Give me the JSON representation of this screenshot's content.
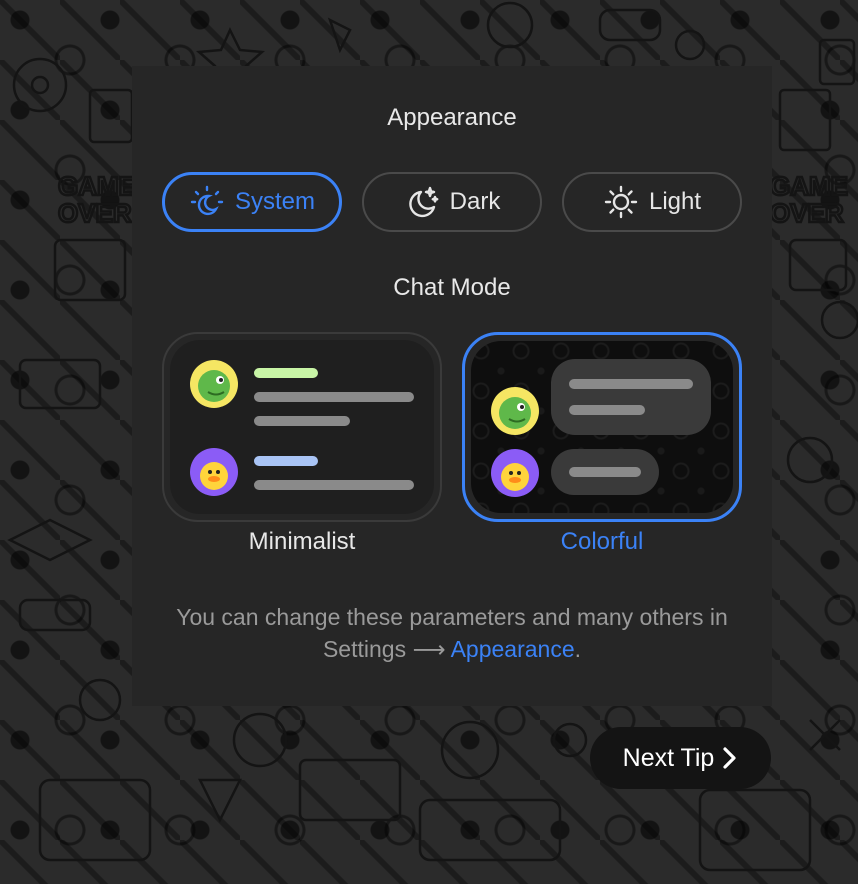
{
  "appearance": {
    "title": "Appearance",
    "options": [
      {
        "label": "System",
        "icon": "sun-moon-icon",
        "selected": true
      },
      {
        "label": "Dark",
        "icon": "moon-stars-icon",
        "selected": false
      },
      {
        "label": "Light",
        "icon": "sun-icon",
        "selected": false
      }
    ]
  },
  "chat_mode": {
    "title": "Chat Mode",
    "options": [
      {
        "label": "Minimalist",
        "selected": false
      },
      {
        "label": "Colorful",
        "selected": true
      }
    ]
  },
  "hint": {
    "text": "You can change these parameters and many others in Settings",
    "arrow": "⟶",
    "link": "Appearance",
    "end": "."
  },
  "next_tip": {
    "label": "Next Tip"
  },
  "colors": {
    "accent": "#3b82f6",
    "panel": "#262626",
    "avatar_dino_bg": "#f5e663",
    "avatar_duck_bg": "#8b5cf6",
    "line_green": "#c8f5a6",
    "line_blue": "#a9c4f5"
  }
}
